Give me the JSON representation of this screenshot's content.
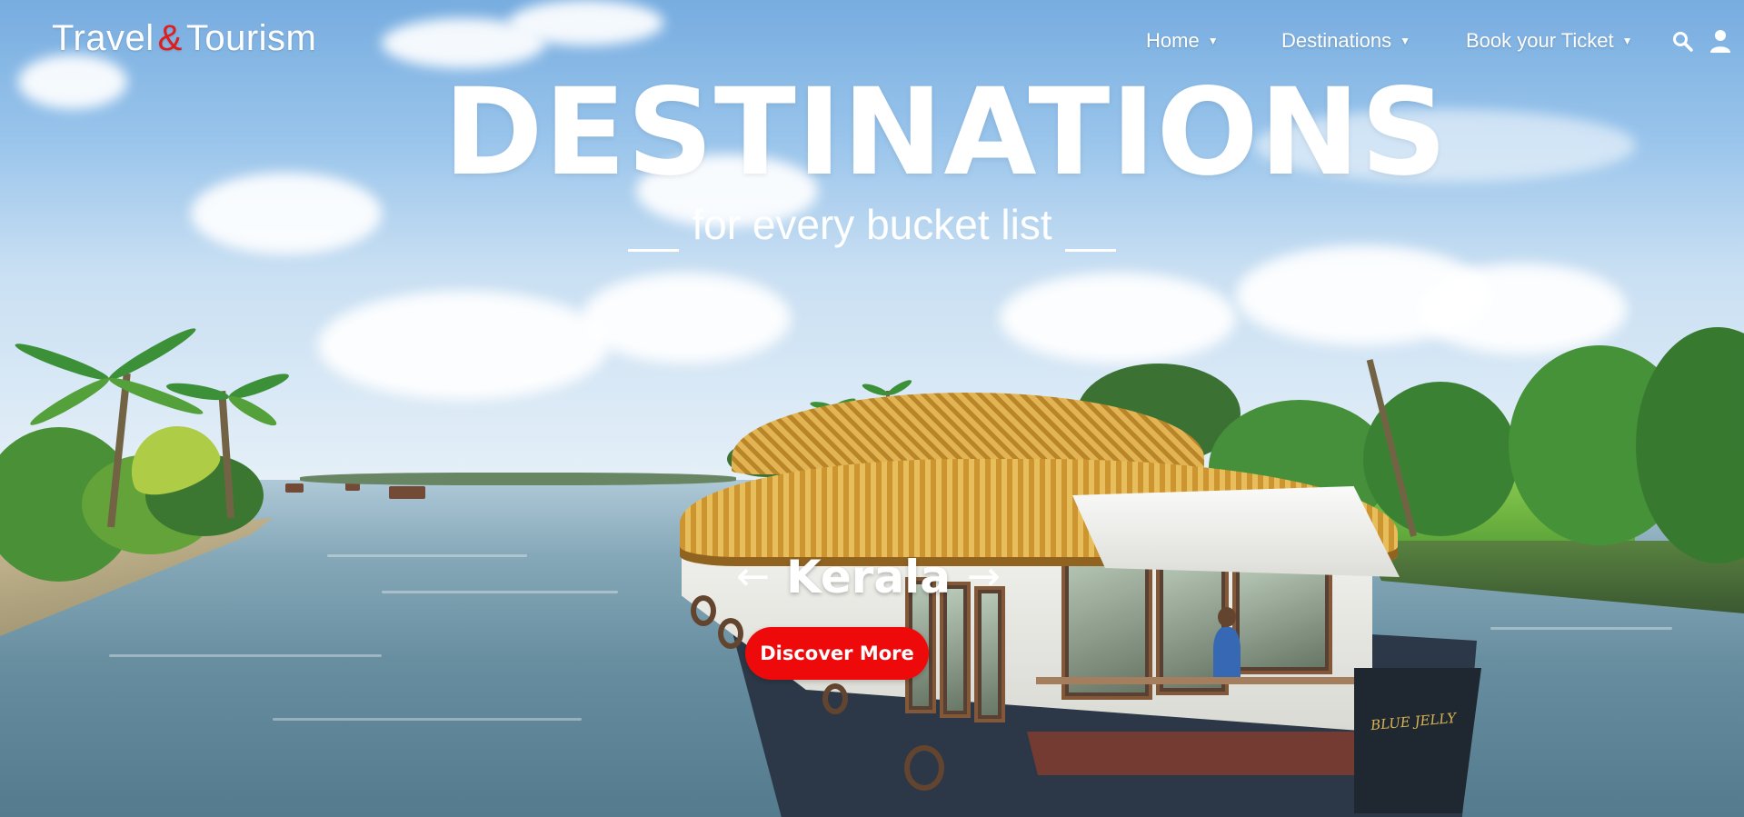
{
  "header": {
    "logo": {
      "part1": "Travel",
      "amp": "&",
      "part2": "Tourism"
    },
    "nav": [
      {
        "label": "Home",
        "caret": "▼"
      },
      {
        "label": "Destinations",
        "caret": "▼"
      },
      {
        "label": "Book your Ticket",
        "caret": "▼"
      }
    ],
    "icons": {
      "search": "search-icon",
      "user": "user-icon"
    }
  },
  "hero": {
    "title": "DESTINATIONS",
    "subtitle": "for every bucket list",
    "place": "Kerala",
    "prev_arrow": "←",
    "next_arrow": "→",
    "cta_label": "Discover More"
  },
  "scene": {
    "boat_name": "BLUE JELLY"
  },
  "colors": {
    "accent": "#ee0a0a",
    "logo_amp": "#e21b1b",
    "text": "#ffffff"
  }
}
